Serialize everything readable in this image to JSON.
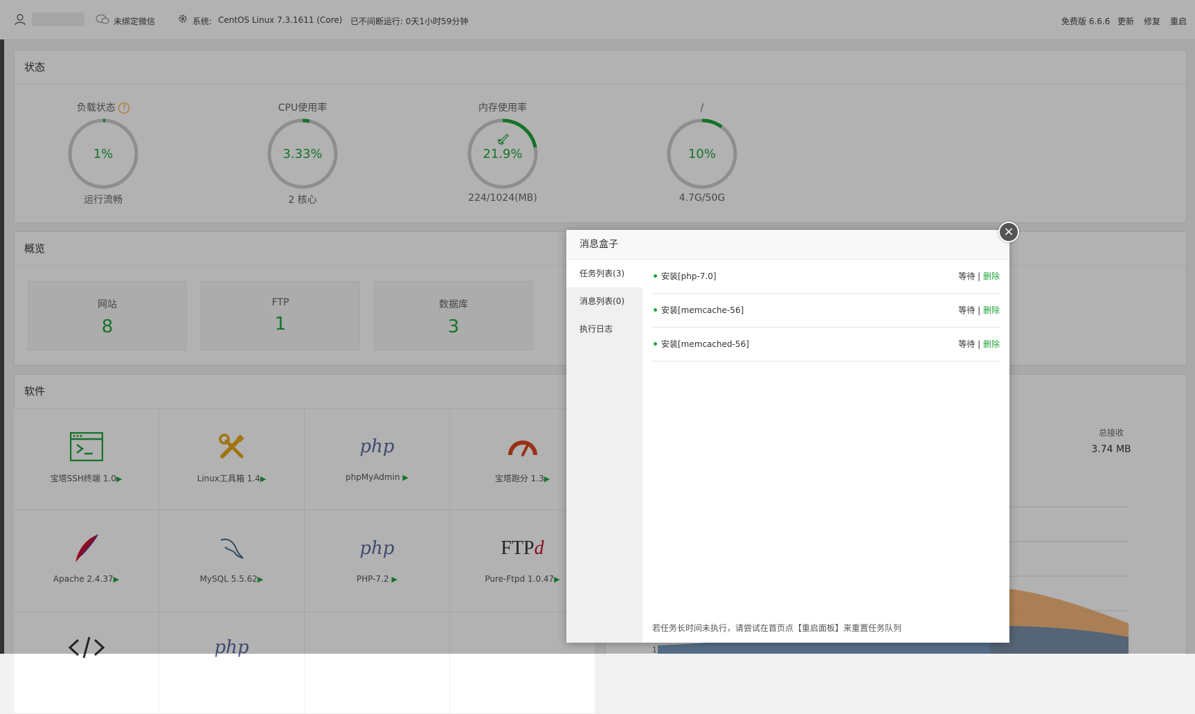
{
  "header": {
    "wechat": "未绑定微信",
    "system_label": "系统:",
    "system_value": "CentOS Linux 7.3.1611 (Core)",
    "uptime": "已不间断运行: 0天1小时59分钟",
    "version": "免费版 6.6.6",
    "update": "更新",
    "repair": "修复",
    "restart": "重启"
  },
  "status": {
    "title": "状态",
    "gauges": [
      {
        "label": "负载状态",
        "value": "1%",
        "sub": "运行流畅",
        "percent": 1
      },
      {
        "label": "CPU使用率",
        "value": "3.33%",
        "sub": "2 核心",
        "percent": 3.33
      },
      {
        "label": "内存使用率",
        "value": "21.9%",
        "sub": "224/1024(MB)",
        "percent": 21.9
      },
      {
        "label": "/",
        "value": "10%",
        "sub": "4.7G/50G",
        "percent": 10
      }
    ]
  },
  "overview": {
    "title": "概览",
    "items": [
      {
        "label": "网站",
        "value": "8"
      },
      {
        "label": "FTP",
        "value": "1"
      },
      {
        "label": "数据库",
        "value": "3"
      }
    ]
  },
  "software": {
    "title": "软件",
    "items": [
      {
        "name": "宝塔SSH终端 1.0",
        "icon": "terminal-icon"
      },
      {
        "name": "Linux工具箱 1.4",
        "icon": "tools-icon"
      },
      {
        "name": "phpMyAdmin",
        "icon": "php-icon",
        "text": "php"
      },
      {
        "name": "宝塔跑分 1.3",
        "icon": "speedometer-icon"
      },
      {
        "name": "Apache 2.4.37",
        "icon": "apache-feather-icon"
      },
      {
        "name": "MySQL 5.5.62",
        "icon": "mysql-dolphin-icon"
      },
      {
        "name": "PHP-7.2",
        "icon": "php-icon",
        "text": "php"
      },
      {
        "name": "Pure-Ftpd 1.0.47",
        "icon": "ftp-icon",
        "text": "FTP"
      },
      {
        "name": "",
        "icon": "code-icon"
      },
      {
        "name": "",
        "icon": "php-icon",
        "text": "php"
      }
    ]
  },
  "traffic": {
    "total_recv_label": "总接收",
    "total_recv_value": "3.74 MB",
    "axis_tick": "1"
  },
  "modal": {
    "title": "消息盒子",
    "tabs": [
      "任务列表(3)",
      "消息列表(0)",
      "执行日志"
    ],
    "tasks": [
      {
        "name": "安装[php-7.0]",
        "status": "等待",
        "action": "删除"
      },
      {
        "name": "安装[memcache-56]",
        "status": "等待",
        "action": "删除"
      },
      {
        "name": "安装[memcached-56]",
        "status": "等待",
        "action": "删除"
      }
    ],
    "separator": "|",
    "footer": "若任务长时间未执行，请尝试在首页点【重启面板】来重置任务队列",
    "close": "×"
  },
  "colors": {
    "accent": "#20a53a",
    "ring": "#cccccc",
    "warn": "#f39800"
  }
}
